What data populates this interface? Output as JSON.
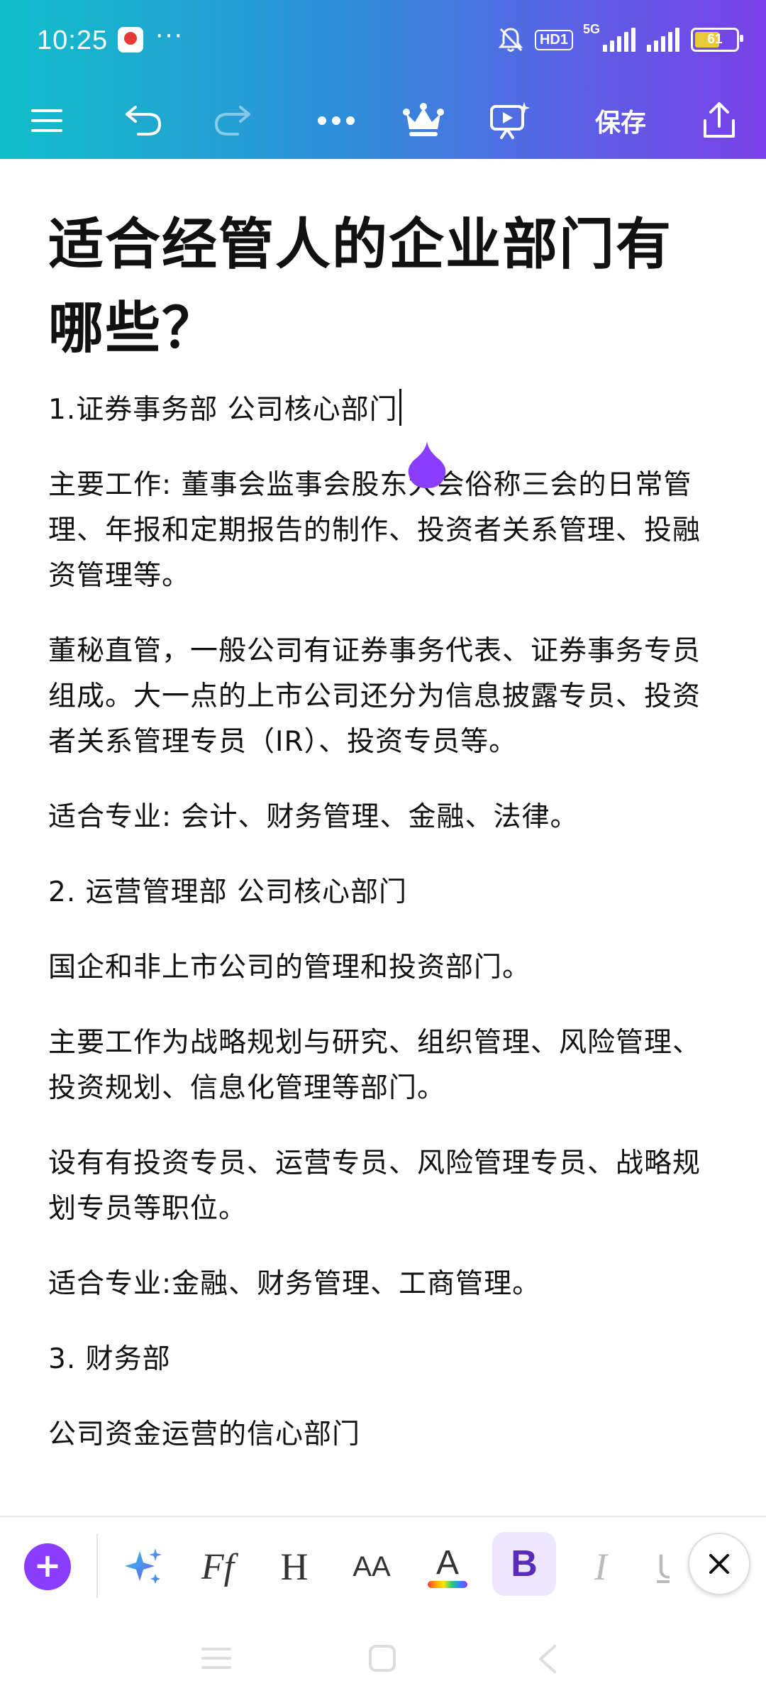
{
  "status_bar": {
    "time": "10:25",
    "more": "···",
    "hd_badge": "HD1",
    "network": "5G",
    "battery_level": "61"
  },
  "toolbar": {
    "menu_icon": "hamburger-menu-icon",
    "undo_icon": "undo-icon",
    "redo_icon": "redo-icon",
    "more_icon": "more-dots-icon",
    "premium_icon": "crown-icon",
    "present_icon": "presentation-icon",
    "save_label": "保存",
    "share_icon": "share-icon"
  },
  "document": {
    "title": "适合经管人的企业部门有哪些？",
    "paragraphs": [
      "1.证券事务部 公司核心部门",
      "主要工作: 董事会监事会股东大会俗称三会的日常管理、年报和定期报告的制作、投资者关系管理、投融资管理等。",
      "董秘直管，一般公司有证券事务代表、证券事务专员组成。大一点的上市公司还分为信息披露专员、投资者关系管理专员（IR）、投资专员等。",
      "适合专业: 会计、财务管理、金融、法律。",
      "2. 运营管理部 公司核心部门",
      "国企和非上市公司的管理和投资部门。",
      "主要工作为战略规划与研究、组织管理、风险管理、投资规划、信息化管理等部门。",
      "设有有投资专员、运营专员、风险管理专员、战略规划专员等职位。",
      "适合专业:金融、财务管理、工商管理。",
      "3. 财务部",
      "公司资金运营的信心部门"
    ]
  },
  "format_bar": {
    "add_label": "+",
    "font_label": "Ff",
    "heading_label": "H",
    "size_label": "AA",
    "color_label": "A",
    "bold_label": "B",
    "italic_label": "I",
    "underline_label": "U",
    "accent_color": "#8b3dff"
  },
  "colors": {
    "header_gradient_start": "#10bfca",
    "header_gradient_end": "#7a3fe8",
    "cursor_handle": "#8b3dff"
  }
}
